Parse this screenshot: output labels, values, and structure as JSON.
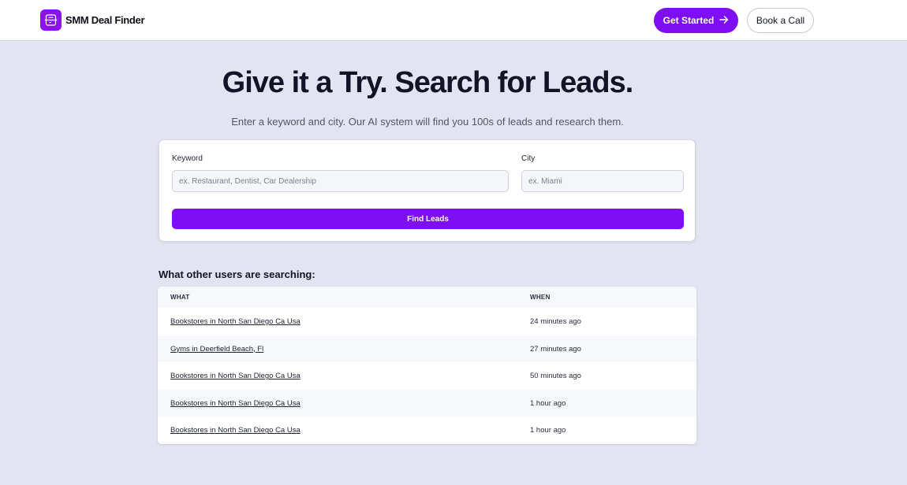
{
  "header": {
    "brand_name": "SMM Deal Finder",
    "brand_icon": "document-bar-icon",
    "get_started_label": "Get Started",
    "get_started_icon": "arrow-right-icon",
    "book_call_label": "Book a Call"
  },
  "hero": {
    "title": "Give it a Try. Search for Leads.",
    "subtitle": "Enter a keyword and city. Our AI system will find you 100s of leads and research them."
  },
  "search": {
    "keyword_label": "Keyword",
    "keyword_placeholder": "ex. Restaurant, Dentist, Car Dealership",
    "keyword_value": "",
    "city_label": "City",
    "city_placeholder": "ex. Miami",
    "city_value": "",
    "submit_label": "Find Leads"
  },
  "recent": {
    "title": "What other users are searching:",
    "columns": {
      "what": "WHAT",
      "when": "WHEN"
    },
    "rows": [
      {
        "what": "Bookstores in North San Diego Ca Usa",
        "when": "24 minutes ago"
      },
      {
        "what": "Gyms in Deerfield Beach, Fl",
        "when": "27 minutes ago"
      },
      {
        "what": "Bookstores in North San Diego Ca Usa",
        "when": "50 minutes ago"
      },
      {
        "what": "Bookstores in North San Diego Ca Usa",
        "when": "1 hour ago"
      },
      {
        "what": "Bookstores in North San Diego Ca Usa",
        "when": "1 hour ago"
      }
    ]
  },
  "colors": {
    "accent": "#7e0ff5",
    "page_background": "#e3e4f1",
    "card_background": "#ffffff"
  }
}
